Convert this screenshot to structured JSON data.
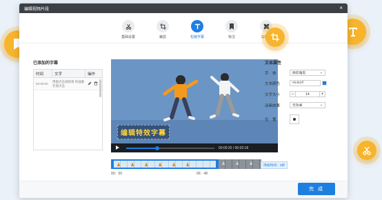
{
  "window": {
    "title": "编辑视频片段",
    "close": "×"
  },
  "toolbar": {
    "tools": [
      {
        "label": "基础设置",
        "icon": "scissors-icon"
      },
      {
        "label": "裁剪",
        "icon": "crop-icon"
      },
      {
        "label": "包装字幕",
        "icon": "text-T-icon",
        "active": true
      },
      {
        "label": "标注",
        "icon": "bookmark-icon"
      },
      {
        "label": "马赛克",
        "icon": "mosaic-icon"
      }
    ]
  },
  "subtitles": {
    "title": "已添加的字幕",
    "columns": [
      "时间",
      "文字",
      "操作"
    ],
    "rows": [
      {
        "time": "00:00:00",
        "text": "用面点击视频将 的插看在视点击"
      }
    ]
  },
  "video": {
    "caption": "编辑特效字幕",
    "current_time": "00:00:25",
    "total_time": "00:02:18",
    "progress": 0.35
  },
  "properties": {
    "title": "文本属性",
    "font_label": "字　体",
    "font_value": "微软雅黑",
    "color_label": "文本颜色",
    "color_value": "#64b2ff",
    "size_label": "文字大小",
    "size_value": "14",
    "effect_label": "动画效果",
    "effect_value": "无效果",
    "position_label": "位　置"
  },
  "timeline": {
    "start": "00：00",
    "mark": "00：48",
    "duration": "持续时间：5秒"
  },
  "footer": {
    "done_label": "完 成"
  },
  "colors": {
    "accent": "#1e7fe0",
    "bubble": "#f7b42c",
    "titlebar": "#3b3f46"
  }
}
